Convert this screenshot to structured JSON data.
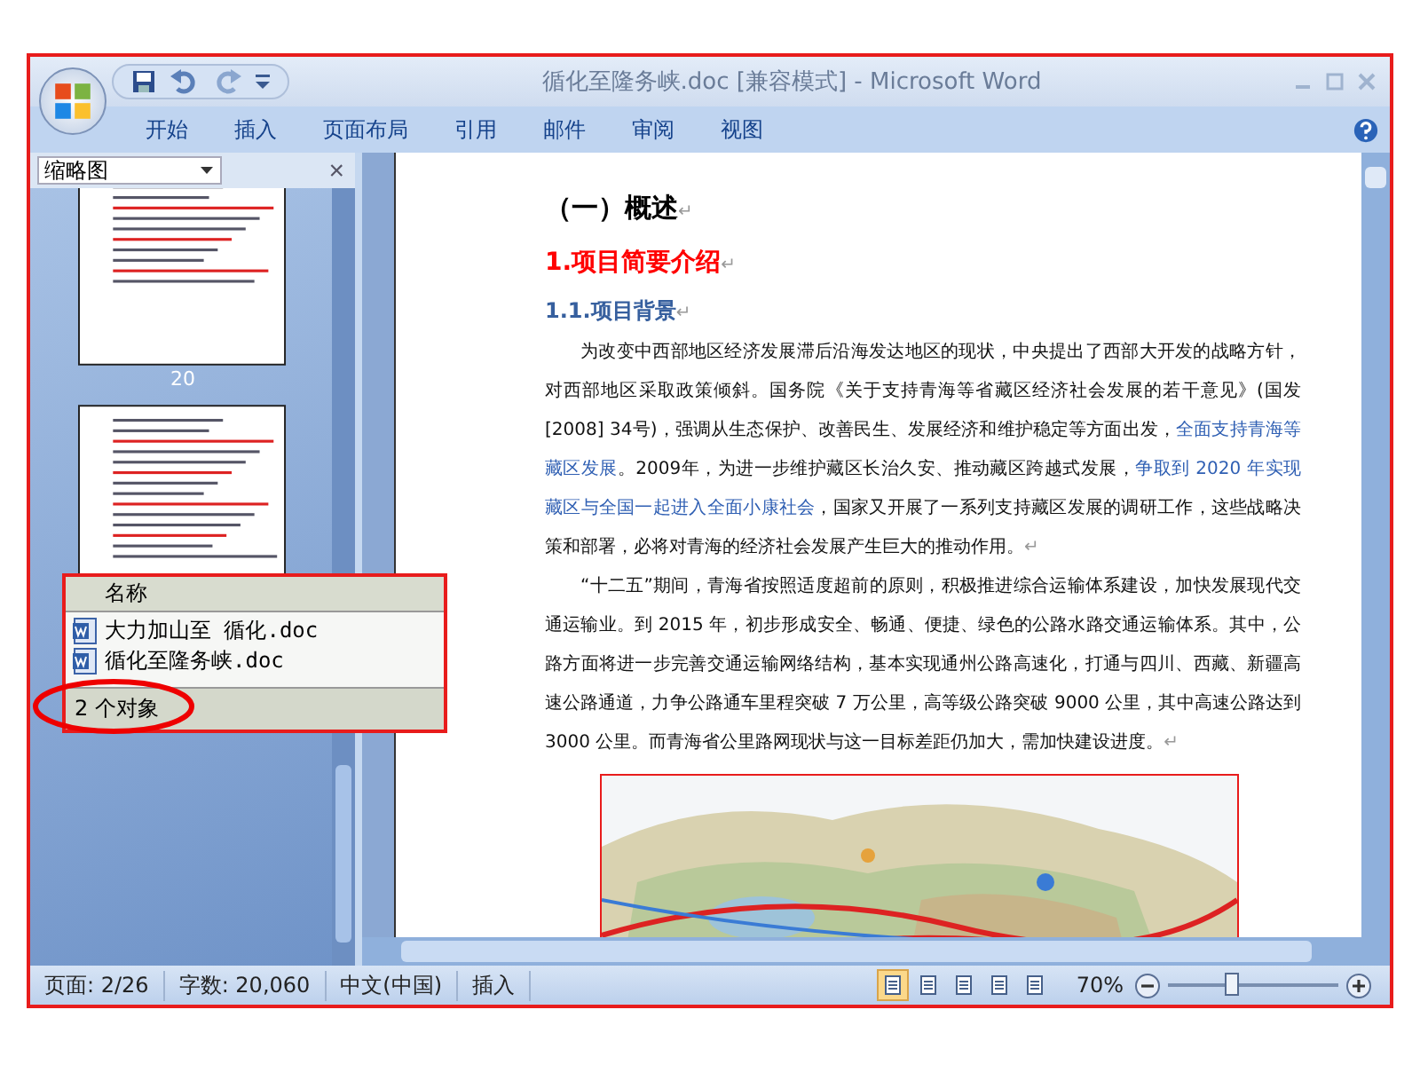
{
  "window": {
    "title": "循化至隆务峡.doc [兼容模式] - Microsoft Word"
  },
  "ribbon_tabs": [
    {
      "label": "开始"
    },
    {
      "label": "插入"
    },
    {
      "label": "页面布局"
    },
    {
      "label": "引用"
    },
    {
      "label": "邮件"
    },
    {
      "label": "审阅"
    },
    {
      "label": "视图"
    }
  ],
  "navigation_pane": {
    "view": "缩略图",
    "close": "×",
    "thumbnails": [
      {
        "kind": "page",
        "page_number": "20"
      },
      {
        "kind": "page"
      }
    ]
  },
  "document": {
    "heading": "（一）概述",
    "section_title": "1.项目简要介绍",
    "subsection_title": "1.1.项目背景",
    "paragraph_mark": "↵",
    "paragraphs": [
      {
        "runs": [
          {
            "text": "为改变中西部地区经济发展滞后沿海发达地区的现状，中央提出了西部大开发的战略方针，对西部地区采取政策倾斜。国务院《关于支持青海等省藏区经济社会发展的若干意见》(国发[2008] 34号)，强调从生态保护、改善民生、发展经济和维护稳定等方面出发，",
            "highlighted": false
          },
          {
            "text": "全面支持青海等藏区发展",
            "highlighted": true
          },
          {
            "text": "。2009年，为进一步维护藏区长治久安、推动藏区跨越式发展，",
            "highlighted": false
          },
          {
            "text": "争取到 2020 年实现藏区与全国一起进入全面小康社会",
            "highlighted": true
          },
          {
            "text": "，国家又开展了一系列支持藏区发展的调研工作，这些战略决策和部署，必将对青海的经济社会发展产生巨大的推动作用。",
            "highlighted": false
          }
        ]
      },
      {
        "runs": [
          {
            "text": "“十二五”期间，青海省按照适度超前的原则，积极推进综合运输体系建设，加快发展现代交通运输业。到 2015 年，初步形成安全、畅通、便捷、绿色的公路水路交通运输体系。其中，公路方面将进一步完善交通运输网络结构，基本实现通州公路高速化，打通与四川、西藏、新疆高速公路通道，力争公路通车里程突破 7 万公里，高等级公路突破 9000 公里，其中高速公路达到 3000 公里。而青海省公里路网现状与这一目标差距仍加大，需加快建设进度。",
            "highlighted": false
          }
        ]
      }
    ]
  },
  "file_list": {
    "column": "名称",
    "files": [
      {
        "name": "大力加山至 循化.doc"
      },
      {
        "name": "循化至隆务峡.doc"
      }
    ],
    "status": "2 个对象"
  },
  "status_bar": {
    "page": "页面: 2/26",
    "words": "字数: 20,060",
    "language": "中文(中国)",
    "mode": "插入",
    "views": [
      {
        "selected": true
      },
      {
        "selected": false
      },
      {
        "selected": false
      },
      {
        "selected": false
      },
      {
        "selected": false
      }
    ],
    "zoom": "70%",
    "zoom_slider": {
      "level": 0.38
    }
  }
}
